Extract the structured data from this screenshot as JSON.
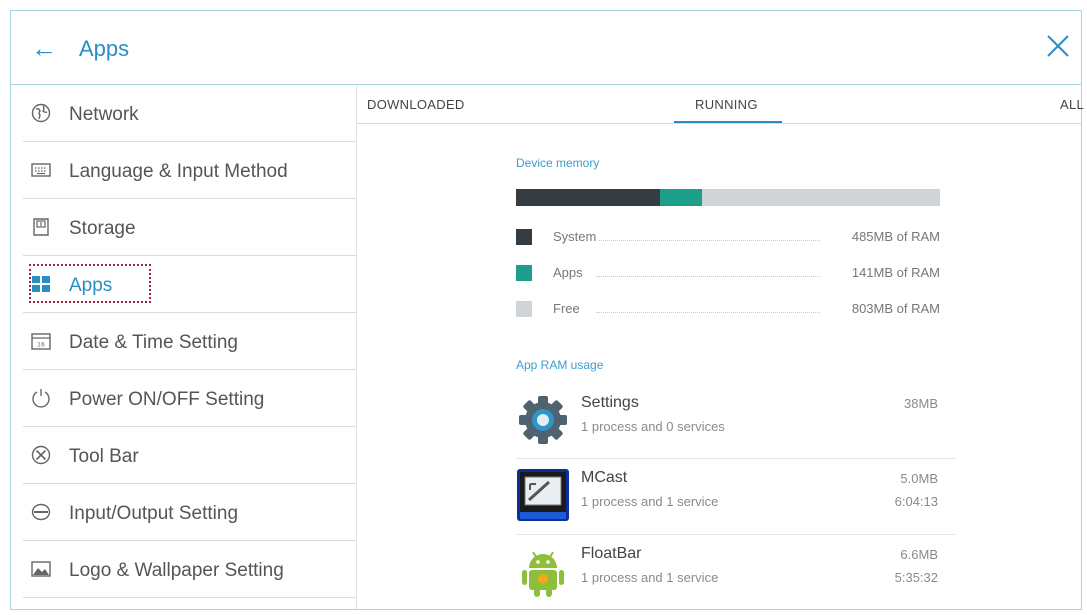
{
  "header": {
    "title": "Apps",
    "back_icon": "arrow-left-icon",
    "close_icon": "close-icon"
  },
  "sidebar": {
    "items": [
      {
        "label": "Network",
        "icon": "globe-icon"
      },
      {
        "label": "Language & Input Method",
        "icon": "keyboard-icon"
      },
      {
        "label": "Storage",
        "icon": "storage-icon"
      },
      {
        "label": "Apps",
        "icon": "apps-grid-icon",
        "active": true
      },
      {
        "label": "Date & Time Setting",
        "icon": "calendar-icon"
      },
      {
        "label": "Power ON/OFF Setting",
        "icon": "power-icon"
      },
      {
        "label": "Tool Bar",
        "icon": "tools-icon"
      },
      {
        "label": "Input/Output Setting",
        "icon": "input-output-icon"
      },
      {
        "label": "Logo & Wallpaper Setting",
        "icon": "image-icon"
      }
    ]
  },
  "tabs": {
    "downloaded": "DOWNLOADED",
    "running": "RUNNING",
    "all": "ALL",
    "selected": "RUNNING"
  },
  "memory": {
    "heading": "Device memory",
    "legend": [
      {
        "name": "System",
        "value": "485MB of RAM",
        "color": "#353c42"
      },
      {
        "name": "Apps",
        "value": "141MB of RAM",
        "color": "#1c9e89"
      },
      {
        "name": "Free",
        "value": "803MB of RAM",
        "color": "#d0d4d6"
      }
    ]
  },
  "app_usage": {
    "heading": "App RAM usage",
    "apps": [
      {
        "name": "Settings",
        "detail": "1 process and 0 services",
        "size": "38MB",
        "time": "",
        "icon": "settings-gear-icon"
      },
      {
        "name": "MCast",
        "detail": "1 process and 1 service",
        "size": "5.0MB",
        "time": "6:04:13",
        "icon": "mcast-icon"
      },
      {
        "name": "FloatBar",
        "detail": "1 process and 1 service",
        "size": "6.6MB",
        "time": "5:35:32",
        "icon": "android-icon"
      }
    ]
  },
  "colors": {
    "accent": "#2b8ec2",
    "selection_border": "#a0223a"
  }
}
